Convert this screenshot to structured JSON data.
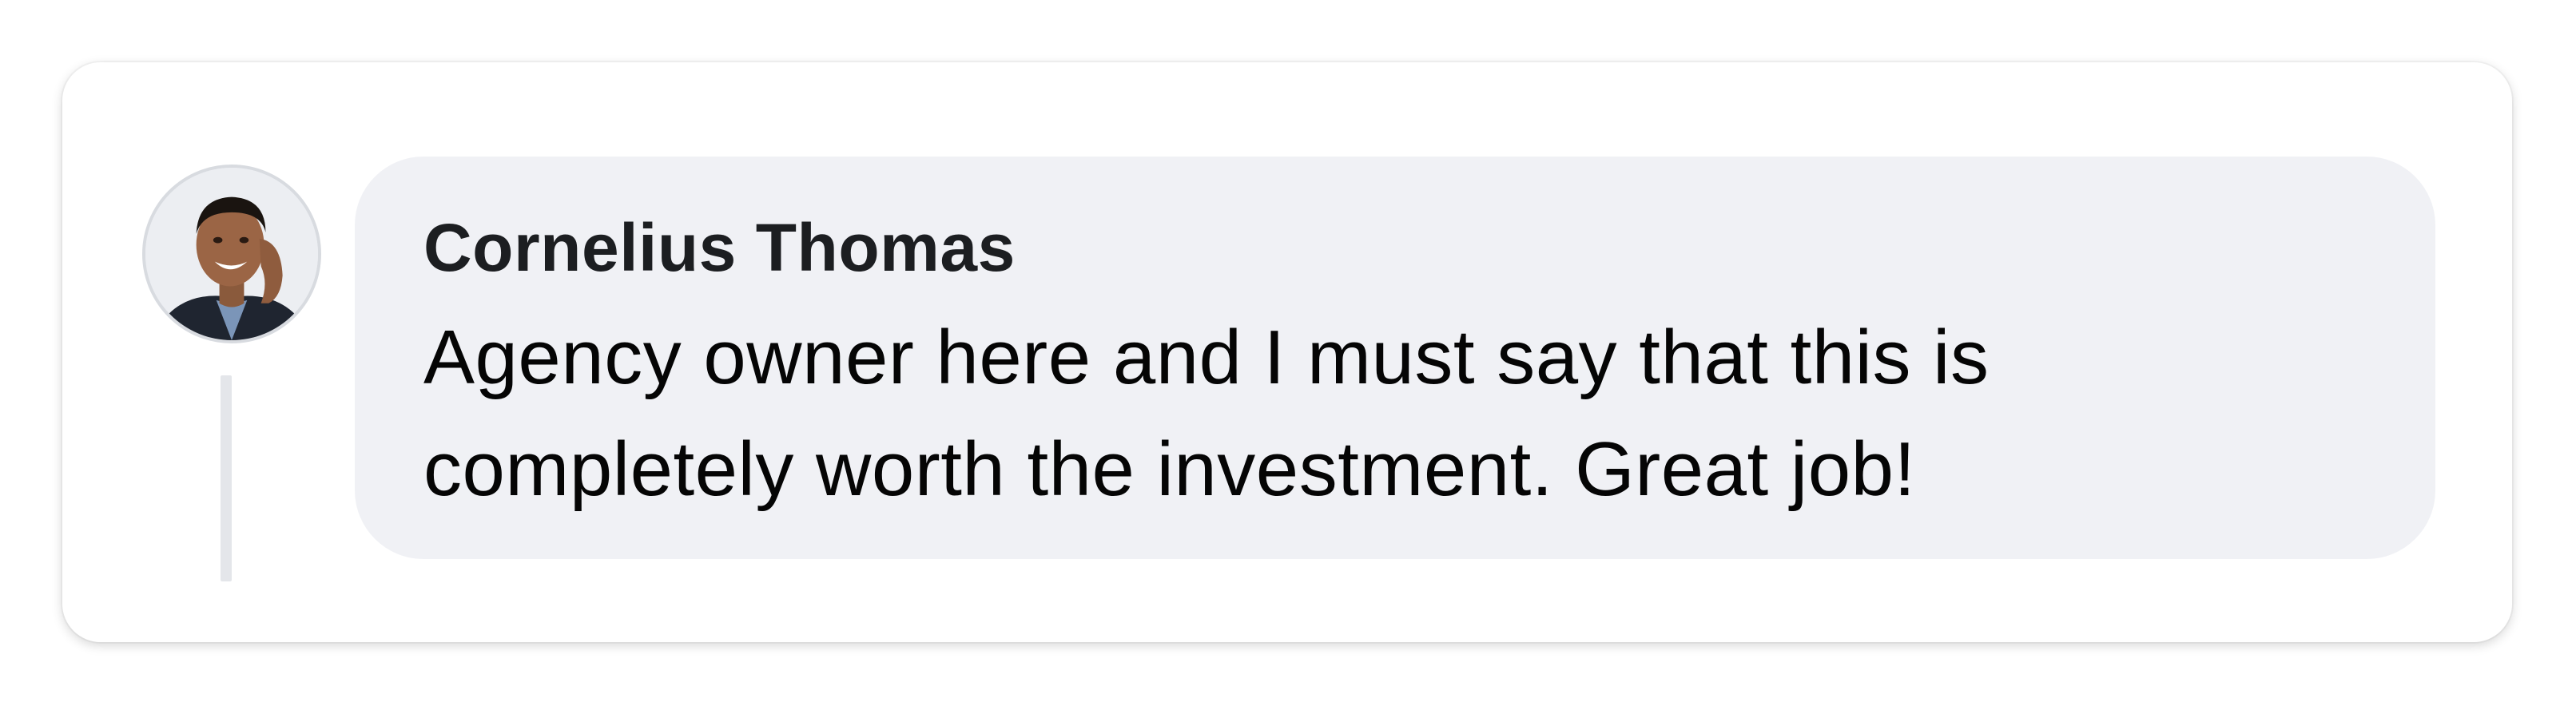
{
  "comment": {
    "author_name": "Cornelius Thomas",
    "text": "Agency owner here and I must say that this is completely worth the investment. Great job!",
    "avatar_icon": "user-avatar-photo"
  },
  "colors": {
    "bubble_background": "#f0f1f5",
    "text": "#050505",
    "thread_line": "#e4e6ea"
  }
}
